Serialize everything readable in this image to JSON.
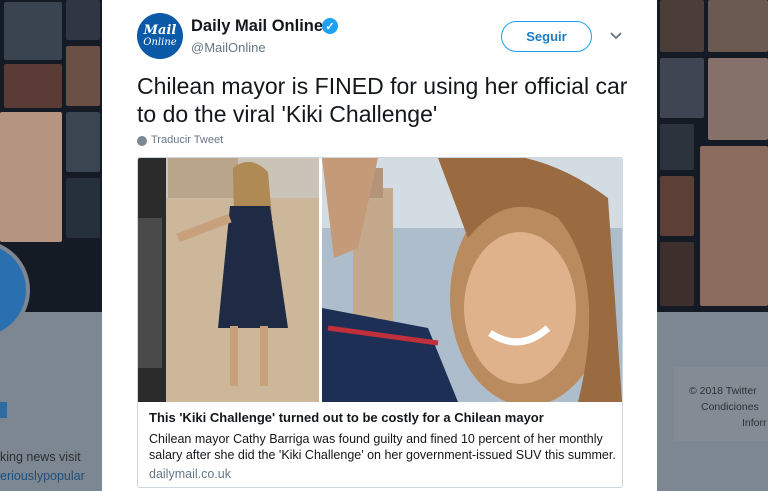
{
  "tweet": {
    "author_name": "Daily Mail Online",
    "author_handle": "@MailOnline",
    "avatar_text_line1": "Mail",
    "avatar_text_line2": "Online",
    "follow_label": "Seguir",
    "text": "Chilean mayor is FINED for using her official car to do the viral 'Kiki Challenge'",
    "translate_label": "Traducir Tweet",
    "card": {
      "title": "This 'Kiki Challenge' turned out to be costly for a Chilean mayor",
      "description": "Chilean mayor Cathy Barriga was found guilty and fined 10 percent of her monthly salary after she did the 'Kiki Challenge' on her government-issued SUV this summer.",
      "domain": "dailymail.co.uk"
    }
  },
  "background_page": {
    "left_text_1": "king news visit",
    "left_text_2": "eriouslypopular",
    "footer_copyright": "© 2018 Twitter",
    "footer_link_1": "Condiciones",
    "footer_link_2": "Inforr"
  },
  "colors": {
    "accent": "#1da1f2",
    "follow_text": "#1b7cc4",
    "avatar_bg": "#0a5aa8"
  },
  "icons": {
    "verified": "verified-badge-icon",
    "caret": "chevron-down-icon",
    "translate": "globe-icon"
  }
}
